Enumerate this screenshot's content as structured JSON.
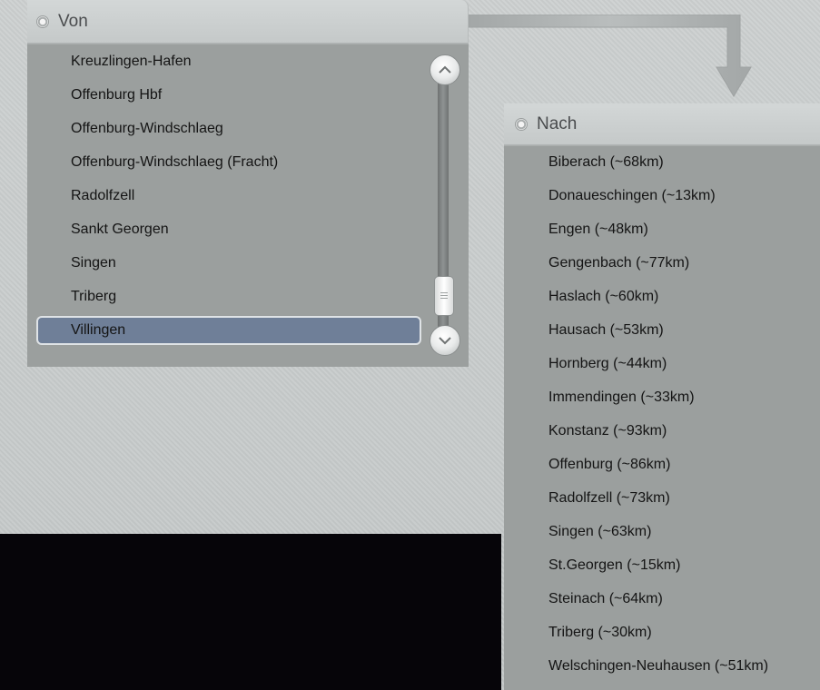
{
  "von": {
    "title": "Von",
    "items": [
      "Kreuzlingen-Hafen",
      "Offenburg Hbf",
      "Offenburg-Windschlaeg",
      "Offenburg-Windschlaeg (Fracht)",
      "Radolfzell",
      "Sankt Georgen",
      "Singen",
      "Triberg",
      "Villingen"
    ],
    "selected": "Villingen"
  },
  "nach": {
    "title": "Nach",
    "items": [
      "Biberach (~68km)",
      "Donaueschingen (~13km)",
      "Engen (~48km)",
      "Gengenbach (~77km)",
      "Haslach (~60km)",
      "Hausach (~53km)",
      "Hornberg (~44km)",
      "Immendingen (~33km)",
      "Konstanz (~93km)",
      "Offenburg (~86km)",
      "Radolfzell (~73km)",
      "Singen (~63km)",
      "St.Georgen (~15km)",
      "Steinach (~64km)",
      "Triberg (~30km)",
      "Welschingen-Neuhausen (~51km)"
    ]
  },
  "colors": {
    "list_bg": "#9b9f9e",
    "selected_bg": "#6f7f98",
    "header_text": "#4a4c4e"
  },
  "icons": {
    "radio": "radio-icon",
    "scroll_up": "chevron-up-icon",
    "scroll_down": "chevron-down-icon",
    "connector": "arrow-down-icon"
  }
}
